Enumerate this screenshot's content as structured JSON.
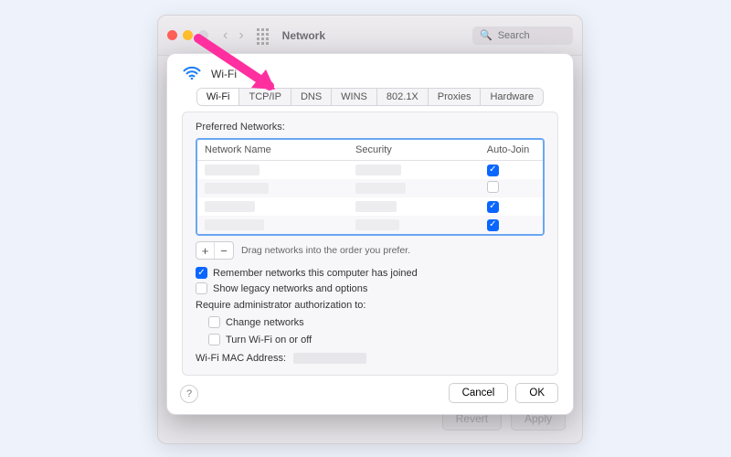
{
  "window": {
    "title": "Network",
    "search_placeholder": "Search",
    "buttons": {
      "revert": "Revert",
      "apply": "Apply"
    }
  },
  "sheet": {
    "interface_name": "Wi-Fi",
    "tabs": [
      "Wi-Fi",
      "TCP/IP",
      "DNS",
      "WINS",
      "802.1X",
      "Proxies",
      "Hardware"
    ],
    "selected_tab": "Wi-Fi",
    "preferred_networks_label": "Preferred Networks:",
    "columns": {
      "name": "Network Name",
      "security": "Security",
      "autojoin": "Auto-Join"
    },
    "rows": [
      {
        "name": "",
        "security": "",
        "autojoin": true
      },
      {
        "name": "",
        "security": "",
        "autojoin": false
      },
      {
        "name": "",
        "security": "",
        "autojoin": true
      },
      {
        "name": "",
        "security": "",
        "autojoin": true
      }
    ],
    "drag_hint": "Drag networks into the order you prefer.",
    "remember_label": "Remember networks this computer has joined",
    "remember_checked": true,
    "legacy_label": "Show legacy networks and options",
    "legacy_checked": false,
    "admin_label": "Require administrator authorization to:",
    "admin_change_label": "Change networks",
    "admin_change_checked": false,
    "admin_toggle_label": "Turn Wi-Fi on or off",
    "admin_toggle_checked": false,
    "mac_label": "Wi-Fi MAC Address:",
    "mac_value": "",
    "cancel": "Cancel",
    "ok": "OK"
  },
  "annotation": {
    "arrow_target": "tab-tcpip"
  }
}
